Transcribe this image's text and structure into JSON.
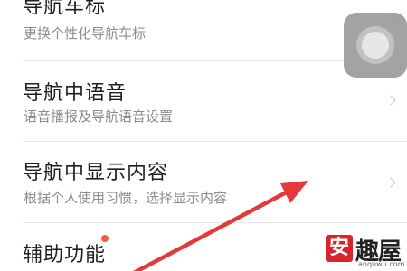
{
  "settings": {
    "items": [
      {
        "title": "导航车标",
        "subtitle": "更换个性化导航车标"
      },
      {
        "title": "导航中语音",
        "subtitle": "语音播报及导航语音设置"
      },
      {
        "title": "导航中显示内容",
        "subtitle": "根据个人使用习惯，选择显示内容"
      },
      {
        "title": "辅助功能",
        "subtitle": ""
      }
    ]
  },
  "icons": {
    "chevron": "chevron-right-icon",
    "float_ball": "assistive-touch-icon",
    "arrow": "red-annotation-arrow"
  },
  "watermark": {
    "badge": "安",
    "text": "趣屋",
    "domain": "anquwu.com"
  },
  "colors": {
    "arrow": "#e5383b",
    "badge_dot": "#f25a4a",
    "watermark_red": "#d9232d"
  }
}
